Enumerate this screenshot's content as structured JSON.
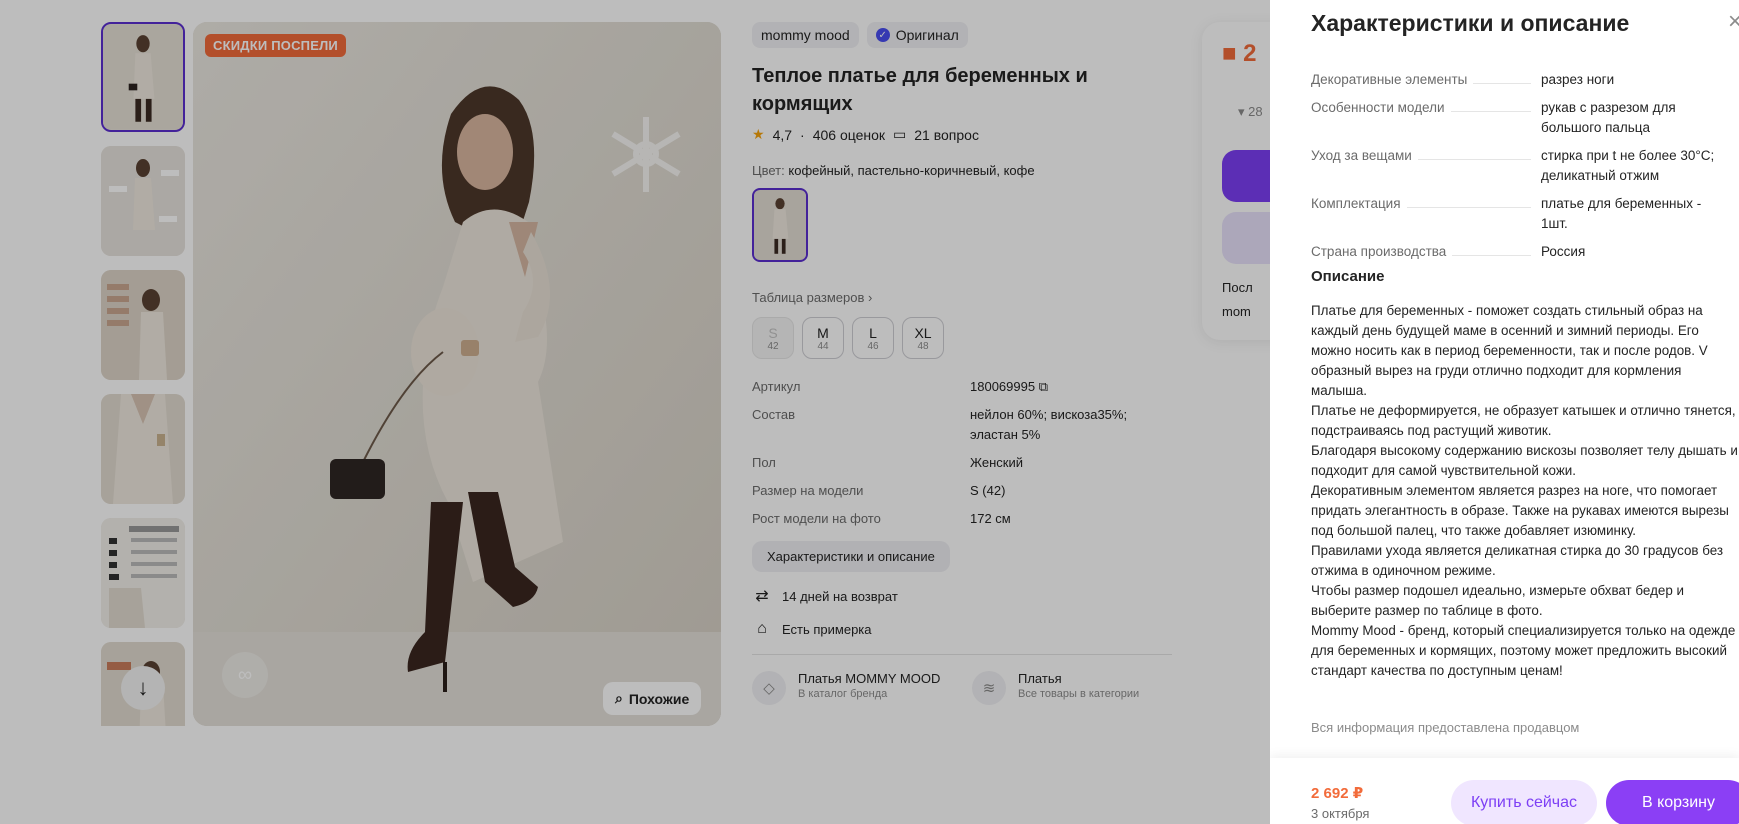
{
  "gallery": {
    "promo_badge": "СКИДКИ ПОСПЕЛИ",
    "similar_label": "Похожие"
  },
  "product": {
    "brand": "mommy mood",
    "original_label": "Оригинал",
    "title": "Теплое платье для беременных и кормящих",
    "rating": "4,7",
    "reviews": "406 оценок",
    "questions": "21 вопрос",
    "color_label": "Цвет:",
    "color_value": "кофейный, пастельно-коричневый, кофе",
    "size_table_label": "Таблица размеров",
    "sizes": [
      {
        "name": "S",
        "num": "42"
      },
      {
        "name": "M",
        "num": "44"
      },
      {
        "name": "L",
        "num": "46"
      },
      {
        "name": "XL",
        "num": "48"
      }
    ],
    "specs": [
      {
        "k": "Артикул",
        "v": "180069995"
      },
      {
        "k": "Состав",
        "v": "нейлон 60%; вискоза35%; эластан 5%"
      },
      {
        "k": "Пол",
        "v": "Женский"
      },
      {
        "k": "Размер на модели",
        "v": "S (42)"
      },
      {
        "k": "Рост модели на фото",
        "v": "172 см"
      }
    ],
    "specs_button": "Характеристики и описание",
    "perk_return": "14 дней на возврат",
    "perk_fitting": "Есть примерка",
    "category_brand_name": "Платья MOMMY MOOD",
    "category_brand_sub": "В каталог бренда",
    "category_name": "Платья",
    "category_sub": "Все товары в категории"
  },
  "buy_card": {
    "price_partial": "2",
    "old_partial": "▾ 28",
    "line1": "Посл",
    "line2": "mom"
  },
  "panel": {
    "title": "Характеристики и описание",
    "specs": [
      {
        "k": "Декоративные элементы",
        "v": "разрез ноги"
      },
      {
        "k": "Особенности модели",
        "v": "рукав с разрезом для большого пальца"
      },
      {
        "k": "Уход за вещами",
        "v": "стирка при t не более 30°С; деликатный отжим"
      },
      {
        "k": "Комплектация",
        "v": "платье для беременных - 1шт."
      },
      {
        "k": "Страна производства",
        "v": "Россия"
      }
    ],
    "description_title": "Описание",
    "description": "Платье для беременных - поможет создать стильный образ на каждый день будущей маме в осенний и зимний периоды. Его можно носить как в период беременности, так и после родов. V образный вырез на груди отлично подходит для кормления малыша.\nПлатье не деформируется, не образует катышек и отлично тянется, подстраиваясь под растущий животик.\nБлагодаря высокому содержанию вискозы позволяет телу дышать и подходит для самой чувствительной кожи.\nДекоративным элементом является разрез на ноге, что помогает придать элегантность в образе. Также на рукавах имеются вырезы под большой палец, что также добавляет изюминку.\nПравилами ухода является деликатная стирка до 30 градусов без отжима в одиночном режиме.\nЧтобы размер подошел идеально, измерьте обхват бедер и выберите размер по таблице в фото.\nMommy Mood - бренд, который специализируется только на одежде для беременных и кормящих, поэтому может предложить высокий стандарт качества по доступным ценам!",
    "seller_note": "Вся информация предоставлена продавцом",
    "price": "2 692 ₽",
    "delivery_date": "3 октября",
    "buy_now": "Купить сейчас",
    "add_to_cart": "В корзину"
  },
  "colors": {
    "accent": "#7d3ff5",
    "price": "#f26b3a",
    "promo": "#f26b3a"
  }
}
